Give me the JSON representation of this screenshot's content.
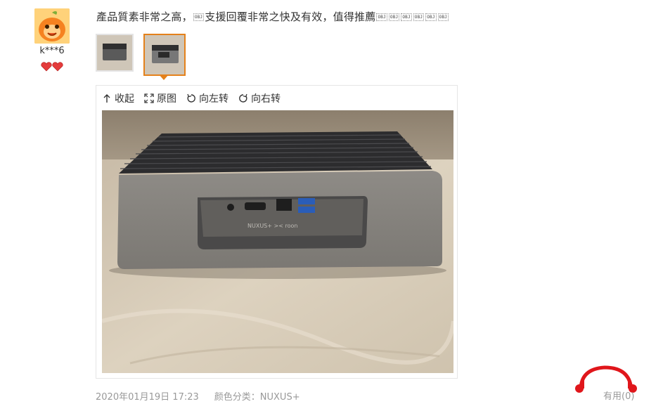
{
  "review": {
    "username": "k***6",
    "text_part1": "產品質素非常之高，",
    "obj_marker": "OBJ",
    "text_part2": "支援回覆非常之快及有效，值得推薦",
    "trailing_obj_markers": [
      "OBJ",
      "OBJ",
      "OBJ",
      "OBJ",
      "OBJ",
      "OBJ"
    ],
    "thumbnail_count": 2,
    "active_thumbnail": 2,
    "date": "2020年01月19日 17:23",
    "variant_label": "颜色分类：",
    "variant_value": "NUXUS+",
    "useful_label": "有用",
    "useful_count": "(0)"
  },
  "viewer_toolbar": {
    "collapse": "收起",
    "original": "原图",
    "rotate_left": "向左转",
    "rotate_right": "向右转"
  },
  "photo": {
    "device_label": "NUXUS+ >< roon"
  },
  "colors": {
    "accent_orange": "#e4811b",
    "logo_red": "#e0161b",
    "avatar_orange": "#ffb534"
  },
  "icons": [
    "avatar-icon",
    "level-hearts-icon",
    "collapse-up-icon",
    "fullscreen-icon",
    "rotate-left-icon",
    "rotate-right-icon",
    "brand-logo-icon"
  ]
}
